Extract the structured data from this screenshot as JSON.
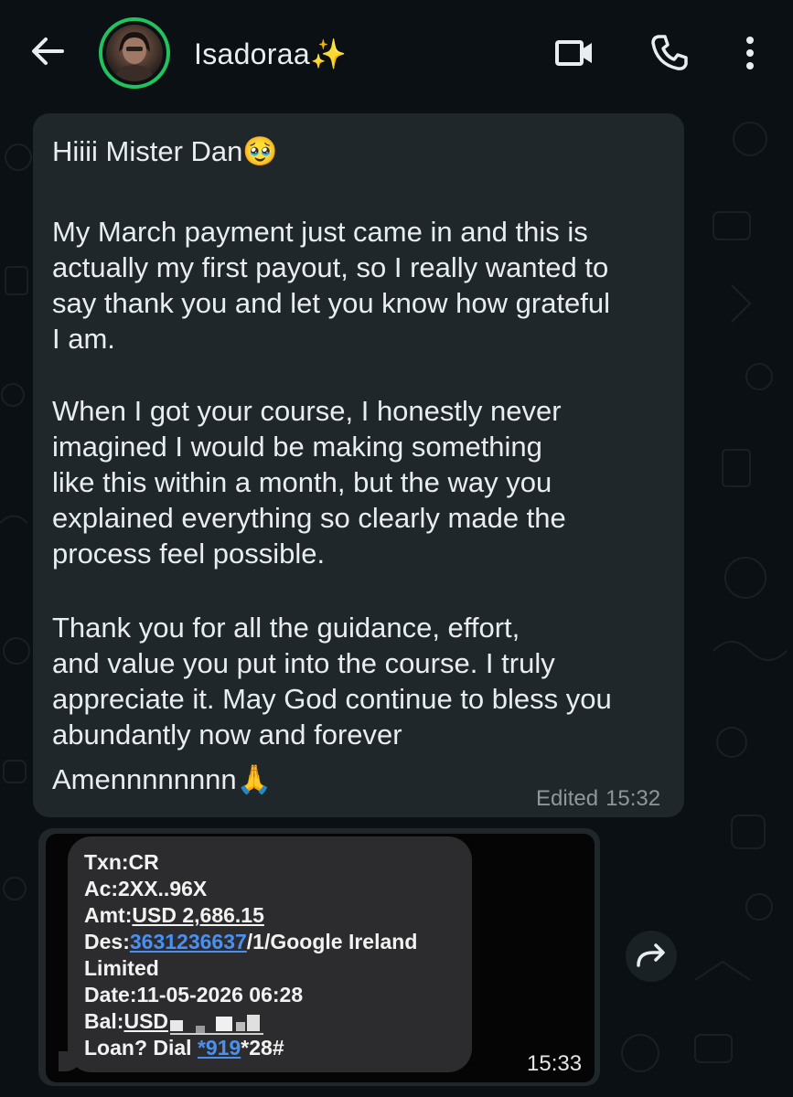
{
  "header": {
    "contact_name": "Isadoraa",
    "contact_emoji": "✨"
  },
  "icons": {
    "back": "arrow-left-icon",
    "video": "video-camera-icon",
    "call": "phone-icon",
    "menu": "more-vertical-icon",
    "forward": "forward-icon"
  },
  "colors": {
    "background": "#0b1014",
    "bubble": "#1f272a",
    "avatar_ring": "#22c35e",
    "meta_text": "#8e969a",
    "link": "#4a90f0"
  },
  "message": {
    "greeting": "Hiiii Mister Dan🥹",
    "p1": [
      "My March payment just came in and this is",
      "actually my first payout, so I really wanted to",
      "say thank you and let you know how grateful",
      "I am."
    ],
    "p2": [
      "When I got your course, I honestly never",
      "imagined I would be making something",
      "like this within a month, but the way you",
      "explained everything so clearly made the",
      "process feel possible."
    ],
    "p3": [
      "Thank you for all the guidance, effort,",
      "and value you put into the course. I truly",
      "appreciate it. May God continue to bless you",
      "abundantly now and forever"
    ],
    "closing": "Amennnnnnnn🙏",
    "edited_label": "Edited",
    "time": "15:32"
  },
  "image_message": {
    "sms": {
      "txn": "Txn:CR",
      "ac": "Ac:2XX..96X",
      "amt_prefix": "Amt:",
      "amt_value": "USD 2,686.15",
      "des_prefix": "Des:",
      "des_link": "3631236637",
      "des_suffix": "/1/Google Ireland",
      "des_line2": "Limited",
      "date": "Date:11-05-2026 06:28",
      "bal_prefix": "Bal:",
      "bal_value": "USD",
      "loan_prefix": "Loan? Dial ",
      "loan_link": "*919",
      "loan_suffix": "*28#"
    },
    "time": "15:33"
  }
}
